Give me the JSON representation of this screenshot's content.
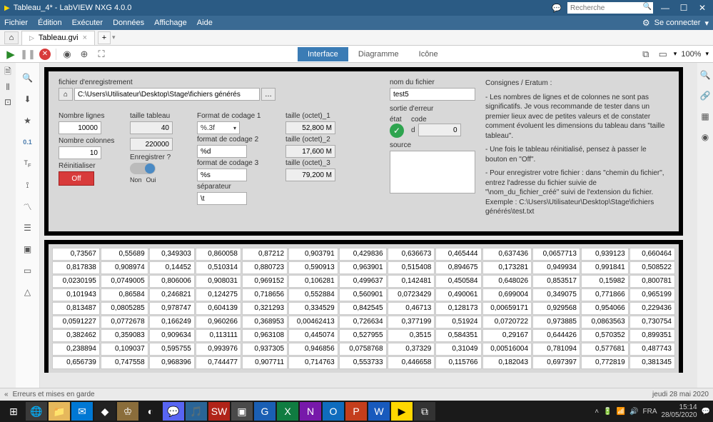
{
  "window": {
    "title": "Tableau_4* - LabVIEW NXG 4.0.0",
    "search_placeholder": "Recherche",
    "connect": "Se connecter"
  },
  "menu": [
    "Fichier",
    "Édition",
    "Exécuter",
    "Données",
    "Affichage",
    "Aide"
  ],
  "doc_tab": "Tableau.gvi",
  "view_tabs": {
    "interface": "Interface",
    "diagram": "Diagramme",
    "icon": "Icône"
  },
  "zoom": "100%",
  "panel": {
    "path_label": "fichier d'enregistrement",
    "path_value": "C:\\Users\\Utilisateur\\Desktop\\Stage\\fichiers générés",
    "nombre_lignes_label": "Nombre lignes",
    "nombre_lignes": "10000",
    "nombre_colonnes_label": "Nombre colonnes",
    "nombre_colonnes": "10",
    "reinit_label": "Réinitialiser",
    "reinit_btn": "Off",
    "taille_tableau_label": "taille tableau",
    "taille_tableau_1": "40",
    "taille_tableau_2": "220000",
    "enregistrer_label": "Enregistrer ?",
    "toggle_non": "Non",
    "toggle_oui": "Oui",
    "format1_label": "Format de codage 1",
    "format1": "%.3f",
    "format2_label": "format de codage 2",
    "format2": "%d",
    "format3_label": "format de codage 3",
    "format3": "%s",
    "sep_label": "séparateur",
    "sep": "\\t",
    "taille1_label": "taille (octet)_1",
    "taille1": "52,800 M",
    "taille2_label": "taille (octet)_2",
    "taille2": "17,600 M",
    "taille3_label": "taille (octet)_3",
    "taille3": "79,200 M",
    "nom_fichier_label": "nom du fichier",
    "nom_fichier": "test5",
    "sortie_err_label": "sortie d'erreur",
    "etat_label": "état",
    "code_label": "code",
    "code_prefix": "d",
    "code_val": "0",
    "source_label": "source",
    "instr_title": "Consignes / Eratum :",
    "instr_1": "- Les nombres de lignes et de colonnes ne sont pas significatifs. Je vous recommande de tester dans un premier lieux avec de petites valeurs et de constater comment évoluent les dimensions du tableau dans \"taille tableau\".",
    "instr_2": "- Une fois le tableau réinitialisé, pensez à passer le bouton en \"Off\".",
    "instr_3": "- Pour enregistrer votre fichier : dans \"chemin du fichier\", entrez l'adresse du fichier suivie de \"\\nom_du_fichier_créé\" suivi de l'extension du fichier. Exemple : C:\\Users\\Utilisateur\\Desktop\\Stage\\fichiers générés\\test.txt"
  },
  "table": [
    [
      "0,73567",
      "0,55689",
      "0,349303",
      "0,860058",
      "0,87212",
      "0,903791",
      "0,429836",
      "0,636673",
      "0,465444",
      "0,637436",
      "0,0657713",
      "0,939123",
      "0,660464"
    ],
    [
      "0,817838",
      "0,908974",
      "0,14452",
      "0,510314",
      "0,880723",
      "0,590913",
      "0,963901",
      "0,515408",
      "0,894675",
      "0,173281",
      "0,949934",
      "0,991841",
      "0,508522"
    ],
    [
      "0,0230195",
      "0,0749005",
      "0,806006",
      "0,908031",
      "0,969152",
      "0,106281",
      "0,499637",
      "0,142481",
      "0,450584",
      "0,648026",
      "0,853517",
      "0,15982",
      "0,800781"
    ],
    [
      "0,101943",
      "0,86584",
      "0,246821",
      "0,124275",
      "0,718656",
      "0,552884",
      "0,560901",
      "0,0723429",
      "0,490061",
      "0,699004",
      "0,349075",
      "0,771866",
      "0,965199"
    ],
    [
      "0,813487",
      "0,0805285",
      "0,978747",
      "0,604139",
      "0,321293",
      "0,334529",
      "0,842545",
      "0,46713",
      "0,128173",
      "0,00659171",
      "0,929568",
      "0,954066",
      "0,229436"
    ],
    [
      "0,0591227",
      "0,0772678",
      "0,166249",
      "0,960266",
      "0,368953",
      "0,00462413",
      "0,726634",
      "0,377199",
      "0,51924",
      "0,0720722",
      "0,973885",
      "0,0863563",
      "0,730754"
    ],
    [
      "0,382462",
      "0,359083",
      "0,909634",
      "0,113111",
      "0,963108",
      "0,445074",
      "0,527955",
      "0,3515",
      "0,584351",
      "0,29167",
      "0,644426",
      "0,570352",
      "0,899351"
    ],
    [
      "0,238894",
      "0,109037",
      "0,595755",
      "0,993976",
      "0,937305",
      "0,946856",
      "0,0758768",
      "0,37329",
      "0,31049",
      "0,00516004",
      "0,781094",
      "0,577681",
      "0,487743"
    ],
    [
      "0,656739",
      "0,747558",
      "0,968396",
      "0,744477",
      "0,907711",
      "0,714763",
      "0,553733",
      "0,446658",
      "0,115766",
      "0,182043",
      "0,697397",
      "0,772819",
      "0,381345"
    ]
  ],
  "statusbar": {
    "left": "Erreurs et mises en garde",
    "right": "jeudi 28 mai 2020"
  },
  "taskbar": {
    "lang": "FRA",
    "time": "15:14",
    "date": "28/05/2020"
  }
}
